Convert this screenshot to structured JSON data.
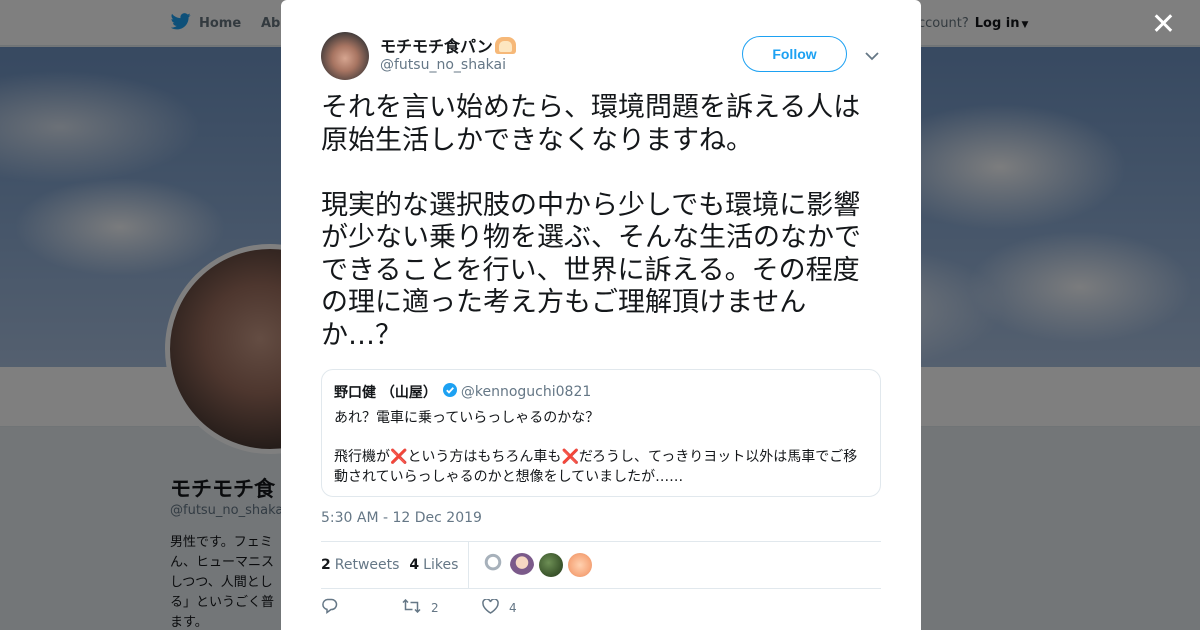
{
  "nav": {
    "home": "Home",
    "about": "Abo",
    "account_prompt": "ccount?",
    "login": "Log in"
  },
  "profile": {
    "name": "モチモチ食",
    "handle": "@futsu_no_shakai",
    "bio": [
      "男性です。フェミ",
      "ん、ヒューマニス",
      "しつつ、人間とし",
      "る」というごく普",
      "ます。"
    ]
  },
  "tweet": {
    "author_name": "モチモチ食パン",
    "author_emoji": "bread-emoji",
    "author_handle": "@futsu_no_shakai",
    "follow_label": "Follow",
    "text": "それを言い始めたら、環境問題を訴える人は\n原始生活しかできなくなりますね。\n\n現実的な選択肢の中から少しでも環境に影響\nが少ない乗り物を選ぶ、そんな生活のなかで\nできることを行い、世界に訴える。その程度\nの理に適った考え方もご理解頂けません\nか…？",
    "timestamp": "5:30 AM - 12 Dec 2019",
    "retweets_count": "2",
    "retweets_label": "Retweets",
    "likes_count": "4",
    "likes_label": "Likes",
    "action_retweet_count": "2",
    "action_like_count": "4"
  },
  "quote": {
    "name": "野口健 （山屋）",
    "verified": true,
    "handle": "@kennoguchi0821",
    "line1": "あれ？電車に乗っていらっしゃるのかな？",
    "line2_a": "飛行機が",
    "line2_b": "という方はもちろん車も",
    "line2_c": "だろうし、てっきりヨット以外は馬車でご移",
    "line3": "動されていらっしゃるのかと想像をしていましたが……",
    "x_mark": "❌"
  },
  "colors": {
    "brand_blue": "#1da1f2",
    "text_primary": "#14171a",
    "text_secondary": "#657786",
    "border": "#e1e8ed"
  }
}
